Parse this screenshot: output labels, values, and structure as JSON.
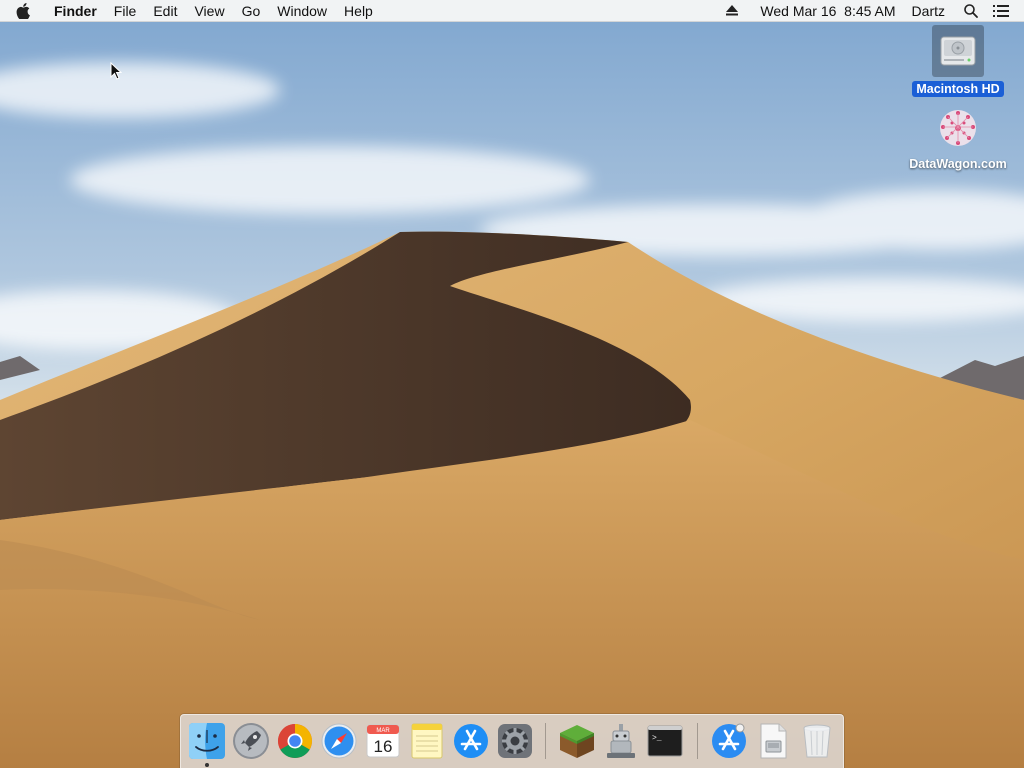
{
  "menubar": {
    "app_name": "Finder",
    "menus": [
      "File",
      "Edit",
      "View",
      "Go",
      "Window",
      "Help"
    ],
    "icons": {
      "apple": "apple-logo-icon",
      "eject": "eject-icon",
      "spotlight": "magnifier-icon",
      "notifications": "list-icon"
    },
    "clock": "Wed Mar 16  8:45 AM",
    "user": "Dartz"
  },
  "desktop": {
    "icons": [
      {
        "label": "Macintosh HD",
        "icon": "hard-drive-icon",
        "selected": true
      },
      {
        "label": "DataWagon.com",
        "icon": "network-server-icon",
        "selected": false
      }
    ]
  },
  "dock": {
    "items": [
      {
        "name": "Finder",
        "icon": "finder-icon",
        "running": true
      },
      {
        "name": "Launchpad",
        "icon": "rocket-icon",
        "running": false
      },
      {
        "name": "Google Chrome",
        "icon": "chrome-icon",
        "running": false
      },
      {
        "name": "Safari",
        "icon": "compass-icon",
        "running": false
      },
      {
        "name": "Calendar",
        "icon": "calendar-icon",
        "running": false,
        "month": "MAR",
        "day": "16"
      },
      {
        "name": "Notes",
        "icon": "notepad-icon",
        "running": false
      },
      {
        "name": "App Store",
        "icon": "app-store-icon",
        "running": false
      },
      {
        "name": "System Preferences",
        "icon": "gear-icon",
        "running": false
      },
      {
        "name": "Minecraft",
        "icon": "grass-block-icon",
        "running": false
      },
      {
        "name": "Automator",
        "icon": "robot-icon",
        "running": false
      },
      {
        "name": "Terminal",
        "icon": "terminal-icon",
        "running": false,
        "prompt": ">_"
      },
      {
        "name": "Downloads",
        "icon": "app-store-folder-icon",
        "running": false
      },
      {
        "name": "Documents",
        "icon": "document-disk-icon",
        "running": false
      },
      {
        "name": "Trash",
        "icon": "trash-icon",
        "running": false
      }
    ]
  },
  "colors": {
    "selection": "#1b5fd6",
    "sky_top": "#7fa6cf",
    "sand_light": "#d7a762",
    "sand_shadow": "#4a3528"
  }
}
